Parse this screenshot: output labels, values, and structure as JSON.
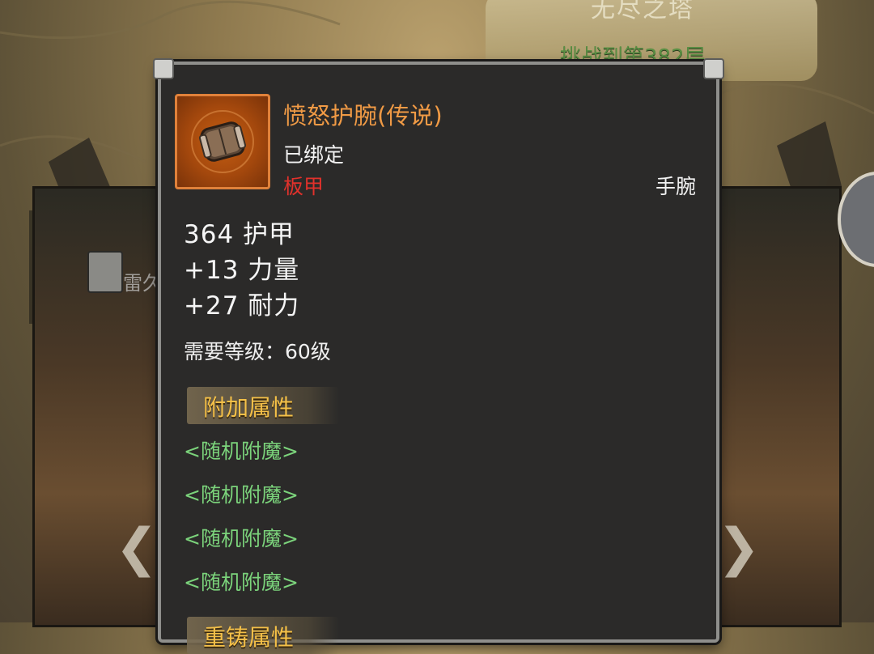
{
  "background": {
    "tower_title": "无尽之塔",
    "challenge_text": "挑战到第382层",
    "side_label": "雷久",
    "nav_left": "❮",
    "nav_right": "❯"
  },
  "tooltip": {
    "item_name": "愤怒护腕(传说)",
    "bound_status": "已绑定",
    "armor_type": "板甲",
    "slot": "手腕",
    "stats": [
      "364 护甲",
      "+13 力量",
      "+27 耐力"
    ],
    "requirement": "需要等级：60级",
    "extra_section_title": "附加属性",
    "enchants": [
      "<随机附魔>",
      "<随机附魔>",
      "<随机附魔>",
      "<随机附魔>"
    ],
    "next_section_title": "重铸属性"
  },
  "colors": {
    "legendary": "#f09a45",
    "plate_red": "#e1312b",
    "enchant_green": "#7bd37b",
    "section_gold": "#f4c048"
  }
}
